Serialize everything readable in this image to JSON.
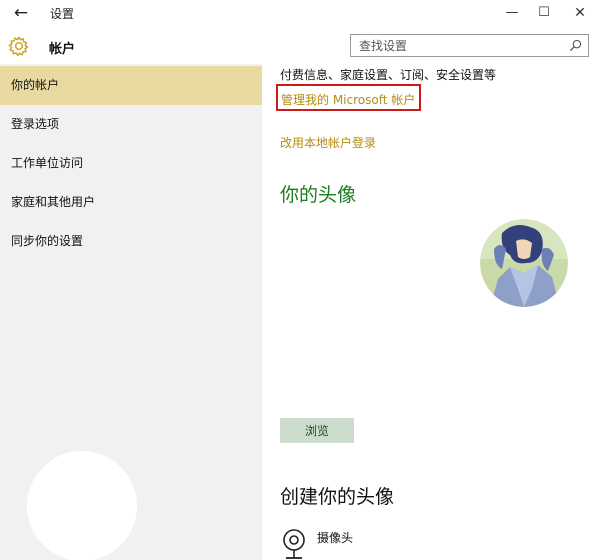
{
  "window": {
    "back_glyph": "←",
    "title": "设置",
    "minimize_glyph": "—",
    "maximize_glyph": "☐",
    "close_glyph": "✕"
  },
  "header": {
    "icon": "gear-icon",
    "title": "帐户",
    "search_placeholder": "查找设置"
  },
  "sidebar": {
    "items": [
      {
        "label": "你的帐户",
        "selected": true
      },
      {
        "label": "登录选项",
        "selected": false
      },
      {
        "label": "工作单位访问",
        "selected": false
      },
      {
        "label": "家庭和其他用户",
        "selected": false
      },
      {
        "label": "同步你的设置",
        "selected": false
      }
    ]
  },
  "main": {
    "sync_text": "付费信息、家庭设置、订阅、安全设置等",
    "manage_link": "管理我的 Microsoft 帐户",
    "local_link": "改用本地帐户登录",
    "avatar_title": "你的头像",
    "browse_button": "浏览",
    "create_title": "创建你的头像",
    "camera_label": "摄像头"
  },
  "colors": {
    "accent": "#b58b12",
    "selected_bg": "#e8d9a0",
    "heading_green": "#1e7a1e",
    "highlight_red": "#cc1a1a"
  }
}
